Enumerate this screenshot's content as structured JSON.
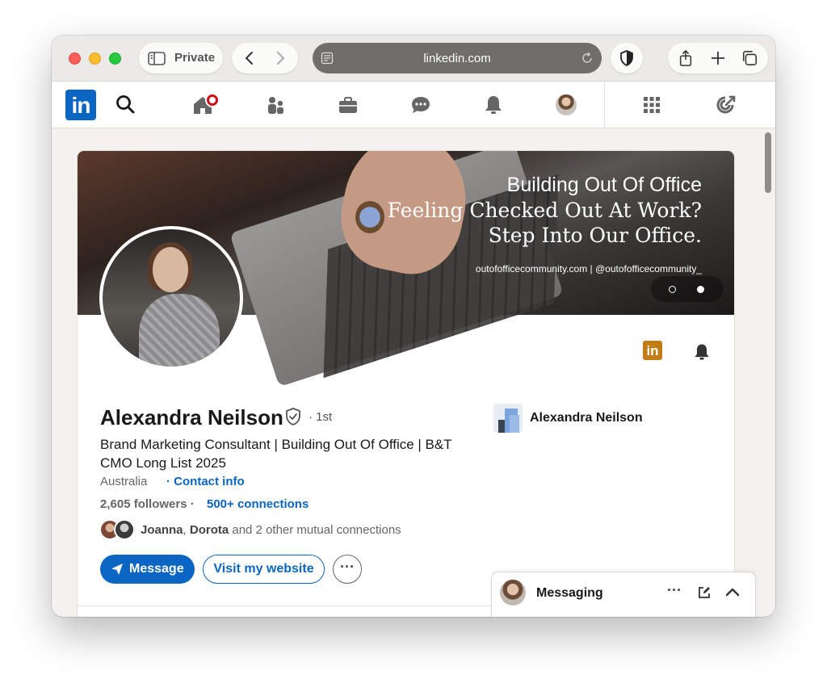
{
  "browser": {
    "private_label": "Private",
    "url": "linkedin.com"
  },
  "linkedin_nav": {
    "logo_text": "in",
    "items": [
      "search-icon",
      "home-icon",
      "network-icon",
      "jobs-icon",
      "messaging-icon",
      "notifications-icon",
      "me-avatar",
      "grid-icon",
      "premium-icon"
    ]
  },
  "banner": {
    "line1": "Building Out Of Office",
    "line2": "Feeling Checked Out At Work?",
    "line3": "Step Into Our Office.",
    "links": "outofofficecommunity.com  |  @outofofficecommunity_"
  },
  "profile": {
    "name": "Alexandra Neilson",
    "degree": "· 1st",
    "headline": "Brand Marketing Consultant | Building Out Of Office | B&T CMO Long List 2025",
    "location": "Australia",
    "contact_link": "· Contact info",
    "followers": "2,605 followers ·",
    "connections": "500+ connections",
    "mutual_names_a": "Joanna",
    "mutual_sep": ", ",
    "mutual_names_b": "Dorota",
    "mutual_rest": " and 2 other mutual connections",
    "message_label": "Message",
    "website_label": "Visit my website",
    "more_label": "···",
    "side_company_name": "Alexandra Neilson"
  },
  "messaging": {
    "title": "Messaging",
    "dots": "···"
  },
  "colors": {
    "linkedin_blue": "#0a66c2",
    "page_bg": "#f4f2ee",
    "notification_red": "#cc1016",
    "premium_gold": "#c37d16"
  }
}
